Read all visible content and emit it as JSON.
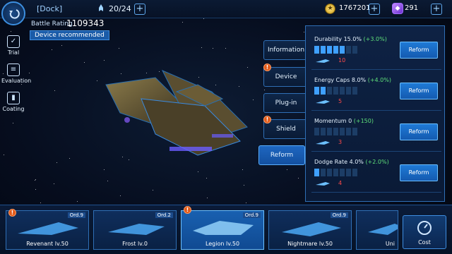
{
  "header": {
    "title": "[Dock]",
    "capacity": "20/24",
    "coins": "1767201",
    "gems": "291"
  },
  "rating": {
    "label": "Battle Rating",
    "value": "1109343",
    "recommend": "Device recommended"
  },
  "side_menu": [
    {
      "label": "Trial",
      "icon": "checkbox-icon"
    },
    {
      "label": "Evaluation",
      "icon": "clipboard-icon"
    },
    {
      "label": "Coating",
      "icon": "spray-can-icon"
    }
  ],
  "tabs": [
    {
      "label": "Information",
      "alert": false,
      "active": false
    },
    {
      "label": "Device",
      "alert": true,
      "active": false
    },
    {
      "label": "Plug-in",
      "alert": false,
      "active": false
    },
    {
      "label": "Shield",
      "alert": true,
      "active": false
    },
    {
      "label": "Reform",
      "alert": false,
      "active": true
    }
  ],
  "reform": {
    "button_label": "Reform",
    "stats": [
      {
        "name": "Durability 15.0%",
        "bonus": "(+3.0%)",
        "level": 5,
        "max": 7,
        "cost": "10"
      },
      {
        "name": "Energy Caps 8.0%",
        "bonus": "(+4.0%)",
        "level": 2,
        "max": 7,
        "cost": "5"
      },
      {
        "name": "Momentum 0",
        "bonus": "(+150)",
        "level": 0,
        "max": 7,
        "cost": "3"
      },
      {
        "name": "Dodge Rate 4.0%",
        "bonus": "(+2.0%)",
        "level": 1,
        "max": 7,
        "cost": "4"
      }
    ]
  },
  "ships": [
    {
      "name": "Revenant lv.50",
      "ord": "Ord.9",
      "alert": true,
      "selected": false
    },
    {
      "name": "Frost lv.0",
      "ord": "Ord.2",
      "alert": false,
      "selected": false
    },
    {
      "name": "Legion lv.50",
      "ord": "Ord.9",
      "alert": true,
      "selected": true
    },
    {
      "name": "Nightmare lv.50",
      "ord": "Ord.9",
      "alert": false,
      "selected": false
    },
    {
      "name": "Uni",
      "ord": "",
      "alert": false,
      "selected": false
    }
  ],
  "cost_button": "Cost",
  "colors": {
    "accent": "#3fa0ff",
    "bonus": "#5fe07a",
    "cost": "#ff4a4a",
    "alert": "#e05a1a"
  }
}
